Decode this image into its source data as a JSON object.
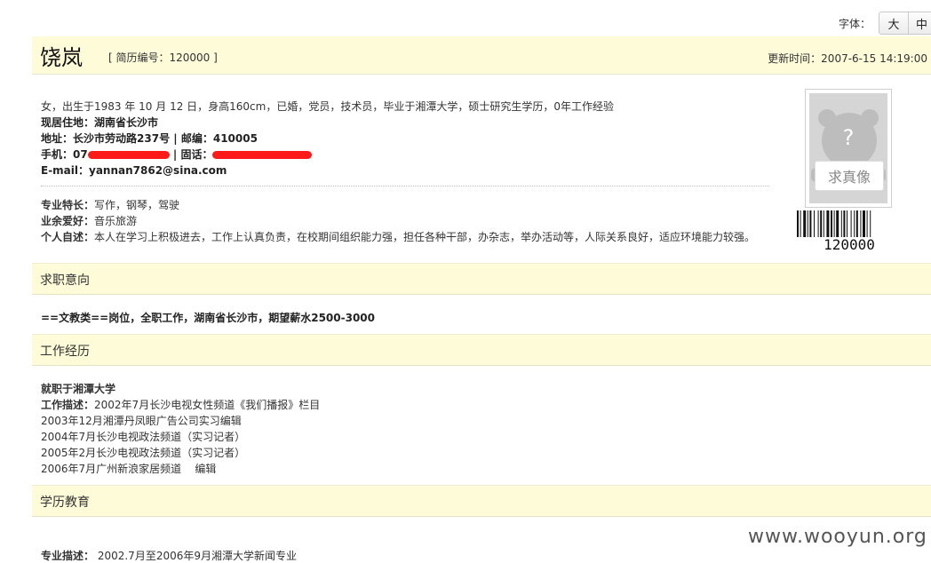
{
  "font_bar": {
    "label": "字体：",
    "large": "大",
    "medium": "中"
  },
  "header": {
    "name": "饶岚",
    "resume_no": "[ 简历编号：120000 ]",
    "updated": "更新时间：2007-6-15 14:19:00"
  },
  "basic": {
    "summary": "女，出生于1983 年 10 月 12 日，身高160cm，已婚，党员，技术员，毕业于湘潭大学，硕士研究生学历，0年工作经验",
    "residence_label": "现居住地：",
    "residence": "湖南省长沙市",
    "address_label": "地址：",
    "address": "长沙市劳动路237号",
    "zip_label": "邮编：",
    "zip": "410005",
    "phone_label": "手机：",
    "phone_visible": "07",
    "tel_label": "固话：",
    "email_label": "E-mail：",
    "email": "yannan7862@sina.com"
  },
  "extra": {
    "skills_label": "专业特长：",
    "skills": "写作，钢琴，驾驶",
    "hobby_label": "业余爱好：",
    "hobby": "音乐旅游",
    "self_label": "个人自述：",
    "self": "本人在学习上积极进去，工作上认真负责，在校期间组织能力强，担任各种干部，办杂志，举办活动等，人际关系良好，适应环境能力较强。"
  },
  "photo": {
    "placeholder": "求真像",
    "question": "?",
    "barcode_number": "120000"
  },
  "sections": {
    "intent_title": "求职意向",
    "work_title": "工作经历",
    "edu_title": "学历教育"
  },
  "intent": "==文教类==岗位，全职工作，湖南省长沙市，期望薪水2500-3000",
  "work": {
    "company": "就职于湘潭大学",
    "desc_label": "工作描述：",
    "lines": [
      "2002年7月长沙电视女性频道《我们播报》栏目",
      "2003年12月湘潭丹凤眼广告公司实习编辑",
      "2004年7月长沙电视政法频道（实习记者）",
      "2005年2月长沙电视政法频道（实习记者）",
      "2006年7月广州新浪家居频道    编辑"
    ]
  },
  "edu": {
    "label": "专业描述：",
    "text": " 2002.7月至2006年9月湘潭大学新闻专业"
  },
  "watermark": "www.wooyun.org",
  "colors": {
    "section_bg": "#fefbd9",
    "redaction": "#ff1a1a"
  }
}
